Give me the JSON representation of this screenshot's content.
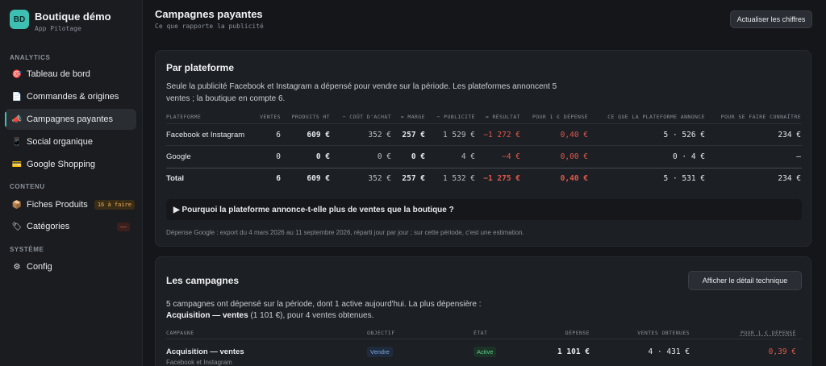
{
  "brand": {
    "logo": "BD",
    "name": "Boutique démo",
    "subtitle": "App Pilotage"
  },
  "sidebar": {
    "sections": [
      {
        "label": "ANALYTICS"
      },
      {
        "label": "CONTENU"
      },
      {
        "label": "SYSTÈME"
      }
    ],
    "items": [
      {
        "label": "Tableau de bord",
        "icon": "target-icon"
      },
      {
        "label": "Commandes & origines",
        "icon": "document-icon"
      },
      {
        "label": "Campagnes payantes",
        "icon": "megaphone-icon",
        "active": true
      },
      {
        "label": "Social organique",
        "icon": "phone-icon"
      },
      {
        "label": "Google Shopping",
        "icon": "card-icon"
      },
      {
        "label": "Fiches Produits",
        "icon": "box-icon",
        "badge": "16 à faire"
      },
      {
        "label": "Catégories",
        "icon": "tag-icon",
        "badge": "—"
      },
      {
        "label": "Config",
        "icon": "gear-icon"
      }
    ]
  },
  "header": {
    "title": "Campagnes payantes",
    "subtitle": "Ce que rapporte la publicité",
    "refresh_button": "Actualiser les chiffres"
  },
  "platform_card": {
    "title": "Par plateforme",
    "intro": "Seule la publicité Facebook et Instagram a dépensé pour vendre sur la période. Les plateformes annoncent 5 ventes ; la boutique en compte 6.",
    "columns": [
      "PLATEFORME",
      "VENTES",
      "PRODUITS HT",
      "− COÛT D'ACHAT",
      "= MARGE",
      "− PUBLICITÉ",
      "= RÉSULTAT",
      "POUR 1 € DÉPENSÉ",
      "CE QUE LA PLATEFORME ANNONCE",
      "POUR SE FAIRE CONNAÎTRE"
    ],
    "rows": [
      [
        "Facebook et Instagram",
        "6",
        "609 €",
        "352 €",
        "257 €",
        "1 529 €",
        "−1 272 €",
        "0,40 €",
        "5 · 526 €",
        "234 €"
      ],
      [
        "Google",
        "0",
        "0 €",
        "0 €",
        "0 €",
        "4 €",
        "−4 €",
        "0,00 €",
        "0 · 4 €",
        "—"
      ]
    ],
    "total": [
      "Total",
      "6",
      "609 €",
      "352 €",
      "257 €",
      "1 532 €",
      "−1 275 €",
      "0,40 €",
      "5 · 531 €",
      "234 €"
    ],
    "accordion": "▶  Pourquoi la plateforme annonce-t-elle plus de ventes que la boutique ?",
    "note": "Dépense Google : export du 4 mars 2026 au 11 septembre 2026, réparti jour par jour ; sur cette période, c'est une estimation."
  },
  "campaigns_card": {
    "title": "Les campagnes",
    "details_button": "Afficher le détail technique",
    "intro_line1": "5 campagnes ont dépensé sur la période, dont 1 active aujourd'hui. La plus dépensière :",
    "intro_bold": "Acquisition — ventes",
    "intro_rest": " (1 101 €), pour 4 ventes obtenues.",
    "columns": [
      "CAMPAGNE",
      "OBJECTIF",
      "ÉTAT",
      "DÉPENSE",
      "VENTES OBTENUES",
      "POUR 1 € DÉPENSÉ"
    ],
    "rows": [
      {
        "name": "Acquisition — ventes",
        "platform": "Facebook et Instagram",
        "objective": "Vendre",
        "state": "Active",
        "spend": "1 101 €",
        "sales": "4 · 431 €",
        "per_euro": "0,39 €"
      }
    ]
  },
  "colors": {
    "accent": "#3dbfb1",
    "negative": "#e0584e",
    "background": "#141619",
    "card": "#1c1f23"
  }
}
